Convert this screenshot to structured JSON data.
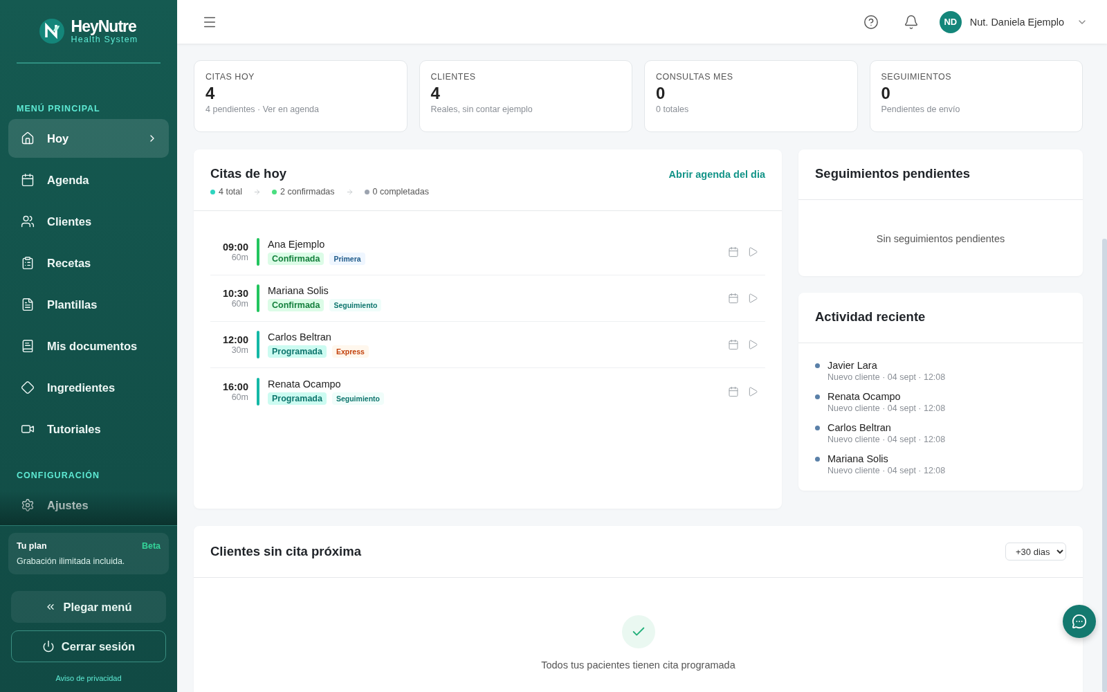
{
  "sidebar": {
    "brand": {
      "name": "HeyNutre",
      "tagline": "Health System"
    },
    "sections": [
      {
        "title": "MENÚ PRINCIPAL",
        "items": [
          {
            "label": "Hoy",
            "selected": true
          },
          {
            "label": "Agenda",
            "selected": false
          },
          {
            "label": "Clientes",
            "selected": false
          },
          {
            "label": "Recetas",
            "selected": false
          },
          {
            "label": "Plantillas",
            "selected": false
          },
          {
            "label": "Mis documentos",
            "selected": false
          },
          {
            "label": "Ingredientes",
            "selected": false
          },
          {
            "label": "Tutoriales",
            "selected": false
          }
        ]
      },
      {
        "title": "CONFIGURACIÓN",
        "items": [
          {
            "label": "Ajustes",
            "selected": false
          }
        ]
      }
    ],
    "plan": {
      "title": "Tu plan",
      "badge": "Beta",
      "text": "Grabación ilimitada incluida."
    },
    "collapse_button": "Plegar menú",
    "logout_button": "Cerrar sesión",
    "privacy_link": "Aviso de privacidad"
  },
  "topbar": {
    "user": {
      "initials": "ND",
      "name": "Nut. Daniela Ejemplo"
    }
  },
  "stats": [
    {
      "label": "CITAS HOY",
      "value": "4",
      "note": "4 pendientes · Ver en agenda"
    },
    {
      "label": "CLIENTES",
      "value": "4",
      "note": "Reales, sin contar ejemplo"
    },
    {
      "label": "CONSULTAS MES",
      "value": "0",
      "note": "0 totales"
    },
    {
      "label": "SEGUIMIENTOS",
      "value": "0",
      "note": "Pendientes de envío"
    }
  ],
  "appointments_panel": {
    "title": "Citas de hoy",
    "link": "Abrir agenda del dia",
    "summary": [
      {
        "text": "4 total",
        "color": "#2dd4bf"
      },
      {
        "text": "2 confirmadas",
        "color": "#4ade80"
      },
      {
        "text": "0 completadas",
        "color": "#9ca3af"
      }
    ],
    "appointments": [
      {
        "time": "09:00",
        "duration": "60m",
        "name": "Ana Ejemplo",
        "status": {
          "label": "Confirmada",
          "kind": "confirmed"
        },
        "type": {
          "label": "Primera",
          "kind": "first"
        }
      },
      {
        "time": "10:30",
        "duration": "60m",
        "name": "Mariana Solis",
        "status": {
          "label": "Confirmada",
          "kind": "confirmed"
        },
        "type": {
          "label": "Seguimiento",
          "kind": "followup"
        }
      },
      {
        "time": "12:00",
        "duration": "30m",
        "name": "Carlos Beltran",
        "status": {
          "label": "Programada",
          "kind": "scheduled"
        },
        "type": {
          "label": "Express",
          "kind": "express"
        }
      },
      {
        "time": "16:00",
        "duration": "60m",
        "name": "Renata Ocampo",
        "status": {
          "label": "Programada",
          "kind": "scheduled"
        },
        "type": {
          "label": "Seguimiento",
          "kind": "followup"
        }
      }
    ]
  },
  "followups_panel": {
    "title": "Seguimientos pendientes",
    "empty": "Sin seguimientos pendientes"
  },
  "activity_panel": {
    "title": "Actividad reciente",
    "items": [
      {
        "name": "Javier Lara",
        "detail": "Nuevo cliente · 04 sept · 12:08"
      },
      {
        "name": "Renata Ocampo",
        "detail": "Nuevo cliente · 04 sept · 12:08"
      },
      {
        "name": "Carlos Beltran",
        "detail": "Nuevo cliente · 04 sept · 12:08"
      },
      {
        "name": "Mariana Solis",
        "detail": "Nuevo cliente · 04 sept · 12:08"
      }
    ]
  },
  "no_appointment_panel": {
    "title": "Clientes sin cita próxima",
    "filter": "+30 dias",
    "empty": "Todos tus pacientes tienen cita programada"
  }
}
